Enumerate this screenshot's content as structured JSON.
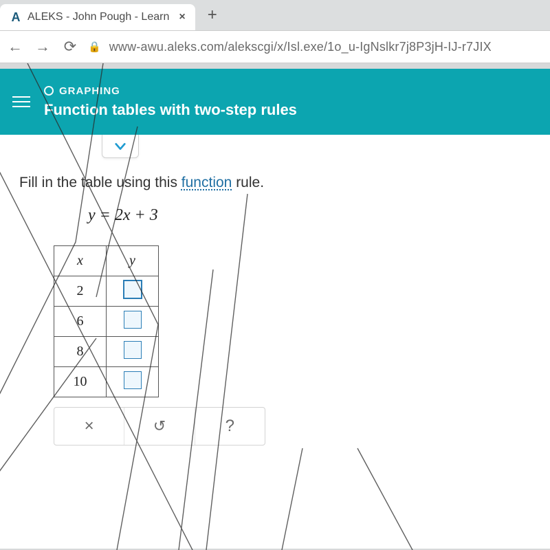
{
  "browser": {
    "tab_title": "ALEKS - John Pough - Learn",
    "url": "www-awu.aleks.com/alekscgi/x/Isl.exe/1o_u-IgNslkr7j8P3jH-IJ-r7JIX"
  },
  "banner": {
    "category": "GRAPHING",
    "title": "Function tables with two-step rules"
  },
  "question": {
    "instruction_prefix": "Fill in the table using this ",
    "instruction_link": "function",
    "instruction_suffix": " rule.",
    "equation": "y = 2x + 3"
  },
  "table": {
    "headers": {
      "x": "x",
      "y": "y"
    },
    "rows": [
      {
        "x": "2",
        "y": ""
      },
      {
        "x": "6",
        "y": ""
      },
      {
        "x": "8",
        "y": ""
      },
      {
        "x": "10",
        "y": ""
      }
    ]
  },
  "toolbar": {
    "clear": "×",
    "undo": "↺",
    "help": "?"
  }
}
